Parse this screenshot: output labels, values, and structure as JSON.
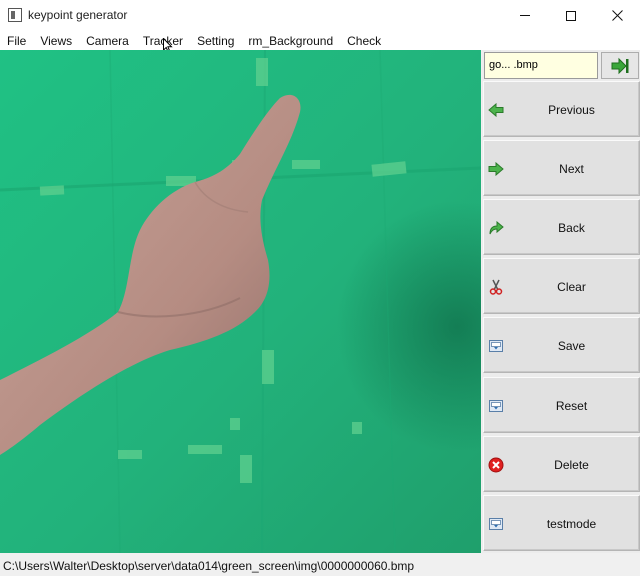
{
  "window": {
    "title": "keypoint generator"
  },
  "menu": {
    "items": [
      "File",
      "Views",
      "Camera",
      "Tracker",
      "Setting",
      "rm_Background",
      "Check"
    ]
  },
  "panel": {
    "file_field_value": "go... .bmp",
    "go_icon": "arrow-to-bar-icon",
    "buttons": [
      {
        "label": "Previous",
        "icon": "arrow-left-icon"
      },
      {
        "label": "Next",
        "icon": "arrow-right-icon"
      },
      {
        "label": "Back",
        "icon": "curved-arrow-icon"
      },
      {
        "label": "Clear",
        "icon": "scissors-icon"
      },
      {
        "label": "Save",
        "icon": "save-icon"
      },
      {
        "label": "Reset",
        "icon": "reset-icon"
      },
      {
        "label": "Delete",
        "icon": "delete-icon"
      },
      {
        "label": "testmode",
        "icon": "testmode-icon"
      }
    ]
  },
  "status": {
    "path": "C:\\Users\\Walter\\Desktop\\server\\data014\\green_screen\\img\\0000000060.bmp"
  },
  "colors": {
    "green_screen": "#25b87a",
    "accent_green": "#3aa63a",
    "delete_red": "#e02020"
  }
}
